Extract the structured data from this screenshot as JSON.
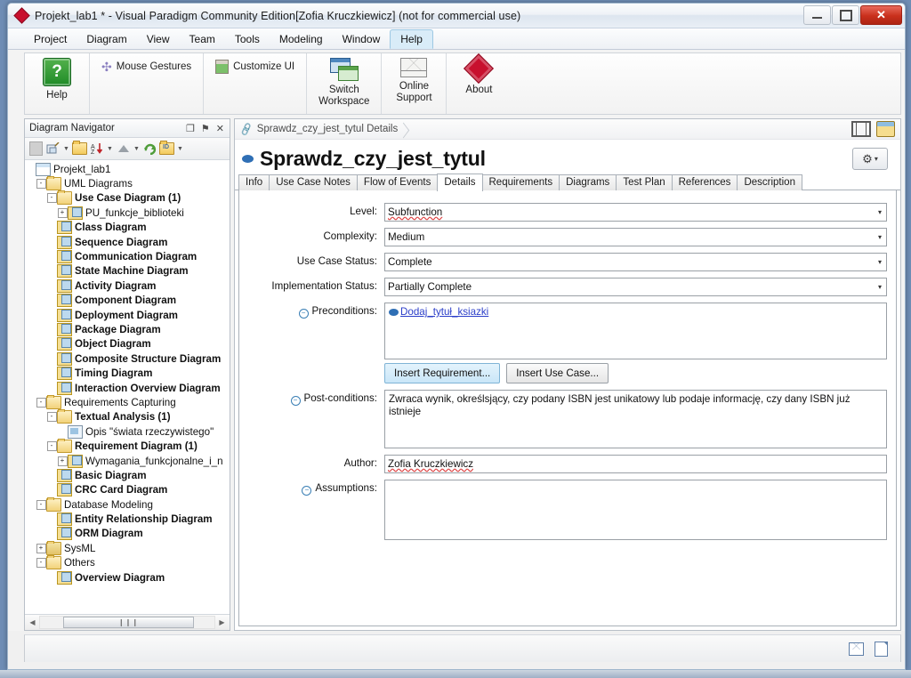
{
  "window": {
    "title": "Projekt_lab1 * - Visual Paradigm Community Edition[Zofia Kruczkiewicz] (not for commercial use)",
    "minimize_label": "Minimize",
    "maximize_label": "Maximize",
    "close_label": "✕"
  },
  "menubar": {
    "items": [
      {
        "label": "Project",
        "active": false
      },
      {
        "label": "Diagram",
        "active": false
      },
      {
        "label": "View",
        "active": false
      },
      {
        "label": "Team",
        "active": false
      },
      {
        "label": "Tools",
        "active": false
      },
      {
        "label": "Modeling",
        "active": false
      },
      {
        "label": "Window",
        "active": false
      },
      {
        "label": "Help",
        "active": true
      }
    ]
  },
  "ribbon": {
    "groups": [
      {
        "buttons": [
          {
            "label": "Help",
            "icon": "help-question-icon",
            "style": "large"
          }
        ]
      },
      {
        "buttons": [
          {
            "label": "Mouse Gestures",
            "icon": "mouse-gestures-icon",
            "style": "small"
          }
        ]
      },
      {
        "buttons": [
          {
            "label": "Customize UI",
            "icon": "customize-ui-icon",
            "style": "small"
          }
        ]
      },
      {
        "buttons": [
          {
            "label": "Switch\nWorkspace",
            "icon": "switch-workspace-icon",
            "style": "large"
          }
        ]
      },
      {
        "buttons": [
          {
            "label": "Online\nSupport",
            "icon": "online-support-mail-icon",
            "style": "large"
          }
        ]
      },
      {
        "buttons": [
          {
            "label": "About",
            "icon": "about-diamond-icon",
            "style": "large"
          }
        ]
      }
    ]
  },
  "navigator": {
    "title": "Diagram Navigator",
    "title_buttons": [
      {
        "name": "restore-icon",
        "glyph": "❐"
      },
      {
        "name": "pin-icon",
        "glyph": "⚑"
      },
      {
        "name": "close-icon",
        "glyph": "✕"
      }
    ],
    "toolbar_icons": [
      "blank-square-icon",
      "new-diagram-icon",
      "dropdown-caret-icon",
      "open-folder-icon",
      "sort-descending-icon",
      "dropdown-caret-icon",
      "collapse-up-icon",
      "dropdown-caret-icon",
      "refresh-icon",
      "folder-tools-icon",
      "dropdown-caret-icon"
    ],
    "tree": [
      {
        "label": "Projekt_lab1",
        "depth": 0,
        "icon": "project-icon",
        "bold": false,
        "expander": ""
      },
      {
        "label": "UML Diagrams",
        "depth": 1,
        "icon": "folder-open-icon",
        "bold": false,
        "expander": "-"
      },
      {
        "label": "Use Case Diagram (1)",
        "depth": 2,
        "icon": "folder-open-icon",
        "bold": true,
        "expander": "-"
      },
      {
        "label": "PU_funkcje_biblioteki",
        "depth": 3,
        "icon": "diagram-icon",
        "bold": false,
        "expander": "+"
      },
      {
        "label": "Class Diagram",
        "depth": 2,
        "icon": "diagram-icon",
        "bold": true,
        "expander": ""
      },
      {
        "label": "Sequence Diagram",
        "depth": 2,
        "icon": "diagram-icon",
        "bold": true,
        "expander": ""
      },
      {
        "label": "Communication Diagram",
        "depth": 2,
        "icon": "diagram-icon",
        "bold": true,
        "expander": ""
      },
      {
        "label": "State Machine Diagram",
        "depth": 2,
        "icon": "diagram-icon",
        "bold": true,
        "expander": ""
      },
      {
        "label": "Activity Diagram",
        "depth": 2,
        "icon": "diagram-icon",
        "bold": true,
        "expander": ""
      },
      {
        "label": "Component Diagram",
        "depth": 2,
        "icon": "diagram-icon",
        "bold": true,
        "expander": ""
      },
      {
        "label": "Deployment Diagram",
        "depth": 2,
        "icon": "diagram-icon",
        "bold": true,
        "expander": ""
      },
      {
        "label": "Package Diagram",
        "depth": 2,
        "icon": "diagram-icon",
        "bold": true,
        "expander": ""
      },
      {
        "label": "Object Diagram",
        "depth": 2,
        "icon": "diagram-icon",
        "bold": true,
        "expander": ""
      },
      {
        "label": "Composite Structure Diagram",
        "depth": 2,
        "icon": "diagram-icon",
        "bold": true,
        "expander": ""
      },
      {
        "label": "Timing Diagram",
        "depth": 2,
        "icon": "diagram-icon",
        "bold": true,
        "expander": ""
      },
      {
        "label": "Interaction Overview Diagram",
        "depth": 2,
        "icon": "diagram-icon",
        "bold": true,
        "expander": ""
      },
      {
        "label": "Requirements Capturing",
        "depth": 1,
        "icon": "folder-open-icon",
        "bold": false,
        "expander": "-"
      },
      {
        "label": "Textual Analysis (1)",
        "depth": 2,
        "icon": "folder-open-icon",
        "bold": true,
        "expander": "-"
      },
      {
        "label": "Opis \"świata rzeczywistego\"",
        "depth": 3,
        "icon": "file-icon",
        "bold": false,
        "expander": ""
      },
      {
        "label": "Requirement Diagram (1)",
        "depth": 2,
        "icon": "folder-open-icon",
        "bold": true,
        "expander": "-"
      },
      {
        "label": "Wymagania_funkcjonalne_i_n",
        "depth": 3,
        "icon": "diagram-icon",
        "bold": false,
        "expander": "+"
      },
      {
        "label": "Basic Diagram",
        "depth": 2,
        "icon": "diagram-icon",
        "bold": true,
        "expander": ""
      },
      {
        "label": "CRC Card Diagram",
        "depth": 2,
        "icon": "diagram-icon",
        "bold": true,
        "expander": ""
      },
      {
        "label": "Database Modeling",
        "depth": 1,
        "icon": "folder-open-icon",
        "bold": false,
        "expander": "-"
      },
      {
        "label": "Entity Relationship Diagram",
        "depth": 2,
        "icon": "diagram-icon",
        "bold": true,
        "expander": ""
      },
      {
        "label": "ORM Diagram",
        "depth": 2,
        "icon": "diagram-icon",
        "bold": true,
        "expander": ""
      },
      {
        "label": "SysML",
        "depth": 1,
        "icon": "folder-closed-icon",
        "bold": false,
        "expander": "+"
      },
      {
        "label": "Others",
        "depth": 1,
        "icon": "folder-open-icon",
        "bold": false,
        "expander": "-"
      },
      {
        "label": "Overview Diagram",
        "depth": 2,
        "icon": "diagram-icon",
        "bold": true,
        "expander": ""
      }
    ],
    "hscroll": {
      "left_arrow": "◀",
      "right_arrow": "▶",
      "thumb_grip": "❙❙❙"
    }
  },
  "editor": {
    "breadcrumb": "Sprawdz_czy_jest_tytul Details",
    "breadcrumb_icon": "link-chain-icon",
    "toolbar_right": [
      {
        "name": "fit-grid-icon"
      },
      {
        "name": "panel-layout-icon"
      }
    ],
    "usecase_title": "Sprawdz_czy_jest_tytul",
    "gear_label": "⚙",
    "gear_caret": "▾",
    "tabs": [
      {
        "label": "Info",
        "active": false
      },
      {
        "label": "Use Case Notes",
        "active": false
      },
      {
        "label": "Flow of Events",
        "active": false
      },
      {
        "label": "Details",
        "active": true
      },
      {
        "label": "Requirements",
        "active": false
      },
      {
        "label": "Diagrams",
        "active": false
      },
      {
        "label": "Test Plan",
        "active": false
      },
      {
        "label": "References",
        "active": false
      },
      {
        "label": "Description",
        "active": false
      }
    ],
    "form": {
      "level": {
        "label": "Level:",
        "value": "Subfunction"
      },
      "complexity": {
        "label": "Complexity:",
        "value": "Medium"
      },
      "use_case_status": {
        "label": "Use Case Status:",
        "value": "Complete"
      },
      "implementation_status": {
        "label": "Implementation Status:",
        "value": "Partially Complete"
      },
      "preconditions": {
        "label": "Preconditions:",
        "link": "Dodaj_tytuł_ksiazki",
        "insert_requirement_label": "Insert Requirement...",
        "insert_use_case_label": "Insert Use Case..."
      },
      "post_conditions": {
        "label": "Post-conditions:",
        "value": "Zwraca wynik, określsjący, czy podany ISBN jest unikatowy lub podaje informację, czy dany ISBN już istnieje"
      },
      "author": {
        "label": "Author:",
        "value": "Zofia Kruczkiewicz"
      },
      "assumptions": {
        "label": "Assumptions:",
        "value": ""
      },
      "caret_glyph": "▾",
      "collapser_glyph": "−"
    }
  },
  "statusbar": {
    "icons": [
      {
        "name": "message-icon"
      },
      {
        "name": "log-document-icon"
      }
    ]
  }
}
